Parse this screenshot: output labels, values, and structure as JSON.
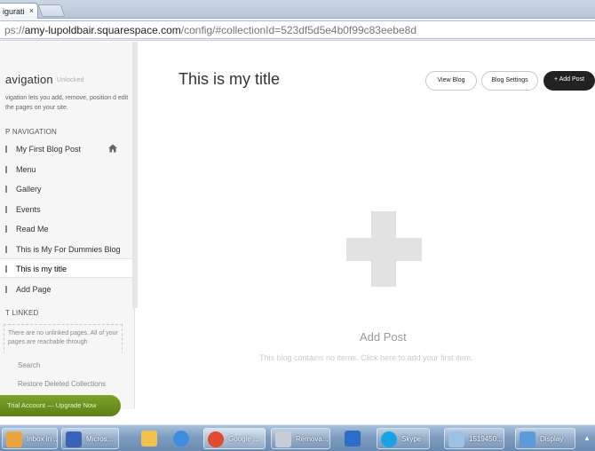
{
  "browser": {
    "tab_title": "igurati",
    "tab_close": "×",
    "url_prefix": "ps://",
    "url_host": "amy-lupoldbair.squarespace.com",
    "url_path": "/config/#collectionId=523df5d5e4b0f99c83eebe8d"
  },
  "sidebar": {
    "title": "avigation",
    "title_badge": "Unlocked",
    "description": "vigation lets you add, remove, position d edit the pages on your site.",
    "top_nav_heading": "P NAVIGATION",
    "items": [
      {
        "label": "My First Blog Post",
        "home": true
      },
      {
        "label": "Menu"
      },
      {
        "label": "Gallery"
      },
      {
        "label": "Events"
      },
      {
        "label": "Read Me"
      },
      {
        "label": "This is My For Dummies Blog"
      },
      {
        "label": "This is my title",
        "active": true
      },
      {
        "label": "Add Page"
      }
    ],
    "unlinked_heading": "T LINKED",
    "unlinked_note": "There are no unlinked pages. All of your pages are reachable through",
    "footer_links": [
      "Search",
      "Restore Deleted Collections"
    ],
    "upgrade_label": "Trial Account — Upgrade Now"
  },
  "main": {
    "title": "This is my title",
    "view_blog": "View Blog",
    "blog_settings": "Blog Settings",
    "add_post_button": "+ Add Post",
    "empty_title": "Add Post",
    "empty_message": "This blog contains no items. Click here to add your first item."
  },
  "taskbar": {
    "items": [
      {
        "label": "Inbox in ...",
        "icon": "mail-icon",
        "color": "#e9a640"
      },
      {
        "label": "Micros...",
        "icon": "word-icon",
        "color": "#3b64b8"
      },
      {
        "label": "",
        "icon": "folder-icon",
        "color": "#f0c24c"
      },
      {
        "label": "",
        "icon": "ie-icon",
        "color": "#3d8ee0"
      },
      {
        "label": "Google ...",
        "icon": "chrome-icon",
        "color": "#e24a2f"
      },
      {
        "label": "Remova...",
        "icon": "drive-icon",
        "color": "#c9ced6"
      },
      {
        "label": "",
        "icon": "outlook-icon",
        "color": "#2d6cc7"
      },
      {
        "label": "Skype",
        "icon": "skype-icon",
        "color": "#17a4e6"
      },
      {
        "label": "1519450...",
        "icon": "paint-icon",
        "color": "#9bc1e4"
      },
      {
        "label": "Display",
        "icon": "display-icon",
        "color": "#5d9ad9"
      }
    ],
    "more": "▴"
  }
}
